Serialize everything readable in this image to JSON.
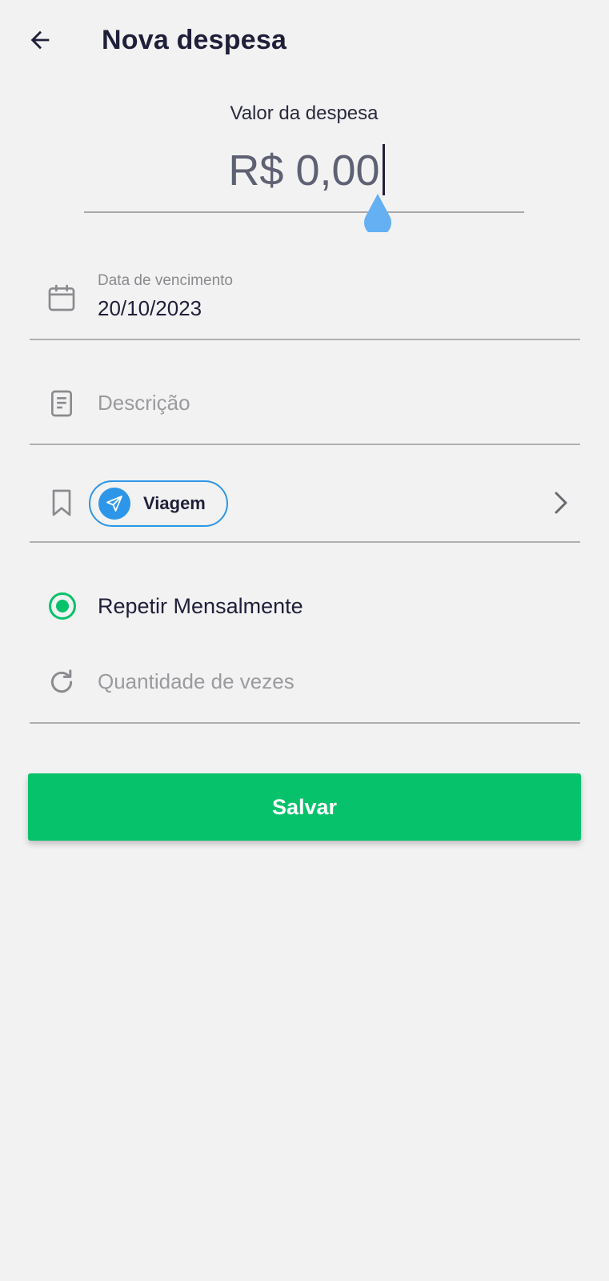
{
  "header": {
    "title": "Nova despesa",
    "back_icon": "arrow-left-icon"
  },
  "amount": {
    "label": "Valor da despesa",
    "value": "R$ 0,00",
    "handle_color": "#64b0f2"
  },
  "due_date": {
    "label": "Data de vencimento",
    "value": "20/10/2023",
    "icon": "calendar-icon"
  },
  "description": {
    "placeholder": "Descrição",
    "icon": "note-icon"
  },
  "category": {
    "label": "Viagem",
    "icon": "paper-plane-icon",
    "row_icon": "bookmark-icon",
    "accent": "#2d96e8"
  },
  "repeat": {
    "label": "Repetir Mensalmente",
    "selected": true,
    "color": "#06c26a"
  },
  "quantity": {
    "placeholder": "Quantidade de vezes",
    "icon": "refresh-icon"
  },
  "actions": {
    "save_label": "Salvar",
    "save_color": "#05c26b"
  }
}
